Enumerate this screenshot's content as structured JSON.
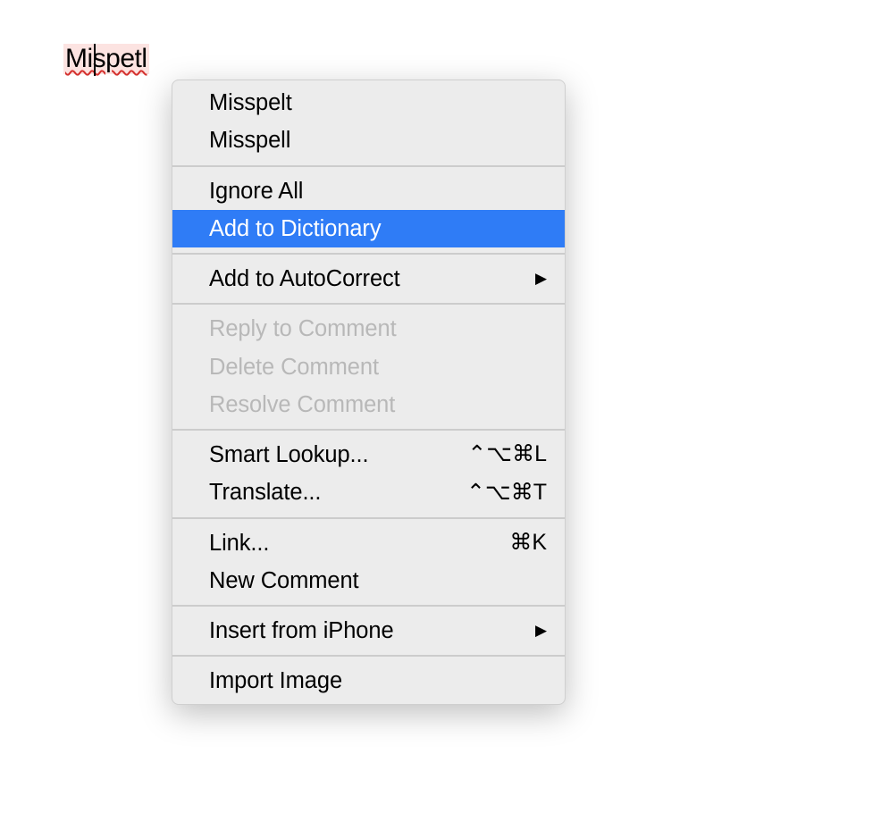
{
  "misspelled_text": "Mispetl",
  "menu": {
    "suggestions": [
      "Misspelt",
      "Misspell"
    ],
    "dictionary": {
      "ignore_all": "Ignore All",
      "add_to_dictionary": "Add to Dictionary"
    },
    "add_to_autocorrect": "Add to AutoCorrect",
    "comments": {
      "reply": "Reply to Comment",
      "delete": "Delete Comment",
      "resolve": "Resolve Comment"
    },
    "lookup": {
      "smart_lookup": "Smart Lookup...",
      "smart_lookup_shortcut": "⌃⌥⌘L",
      "translate": "Translate...",
      "translate_shortcut": "⌃⌥⌘T"
    },
    "link": {
      "link": "Link...",
      "link_shortcut": "⌘K",
      "new_comment": "New Comment"
    },
    "insert_from_iphone": "Insert from iPhone",
    "import_image": "Import Image"
  }
}
